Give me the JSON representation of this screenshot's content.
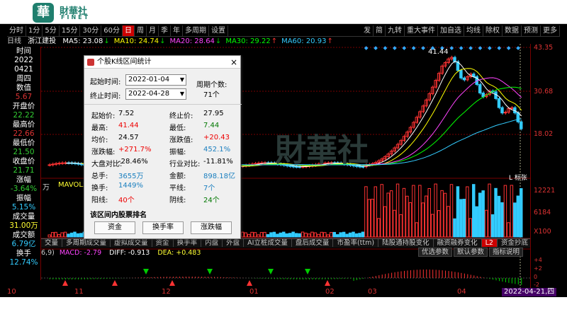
{
  "brand": {
    "logo_glyph": "華",
    "name_cn": "財華社",
    "name_en": "FINET",
    "accent": "#1f7f6e"
  },
  "toolbar": {
    "left": [
      "分时",
      "1分",
      "5分",
      "15分",
      "30分",
      "60分",
      "日",
      "周",
      "月",
      "季",
      "年",
      "多周期",
      "设置"
    ],
    "active": "日",
    "right": [
      "发",
      "简",
      "九转",
      "重大事件",
      "加自选",
      "均线",
      "除权",
      "数据",
      "预测",
      "更多"
    ]
  },
  "ma_legend": {
    "period_label": "日线",
    "stock": "浙江建投",
    "items": [
      {
        "label": "MA5: 23.08",
        "color": "#ffffff",
        "arrow": "↓",
        "arrow_color": "#00cc00"
      },
      {
        "label": "MA10: 24.74",
        "color": "#ffff00",
        "arrow": "↓",
        "arrow_color": "#00cc00"
      },
      {
        "label": "MA20: 28.64",
        "color": "#ff44ff",
        "arrow": "↓",
        "arrow_color": "#00cc00"
      },
      {
        "label": "MA30: 29.22",
        "color": "#00ff00",
        "arrow": "↑",
        "arrow_color": "#ff3333"
      },
      {
        "label": "MA60: 20.93",
        "color": "#33ccff",
        "arrow": "↑",
        "arrow_color": "#ff3333"
      }
    ]
  },
  "left_panel": [
    {
      "t": "时间",
      "c": "#ffffff"
    },
    {
      "t": "2022",
      "c": "#ffffff"
    },
    {
      "t": "0421",
      "c": "#ffffff"
    },
    {
      "t": "周四",
      "c": "#ffffff"
    },
    {
      "t": "数值",
      "c": "#ffffff"
    },
    {
      "t": "5.67",
      "c": "#dd3333"
    },
    {
      "t": "开盘价",
      "c": "#ffffff"
    },
    {
      "t": "22.22",
      "c": "#33cc33"
    },
    {
      "t": "最高价",
      "c": "#ffffff"
    },
    {
      "t": "22.66",
      "c": "#dd3333"
    },
    {
      "t": "最低价",
      "c": "#ffffff"
    },
    {
      "t": "21.50",
      "c": "#33cc33"
    },
    {
      "t": "收盘价",
      "c": "#ffffff"
    },
    {
      "t": "21.71",
      "c": "#33cc33"
    },
    {
      "t": "涨幅",
      "c": "#ffffff"
    },
    {
      "t": "-3.64%",
      "c": "#33cc33"
    },
    {
      "t": "振幅",
      "c": "#ffffff"
    },
    {
      "t": "5.15%",
      "c": "#33ccff"
    },
    {
      "t": "成交量",
      "c": "#ffffff"
    },
    {
      "t": "31.00万",
      "c": "#ffff33"
    },
    {
      "t": "成交额",
      "c": "#ffffff"
    },
    {
      "t": "6.79亿",
      "c": "#33ccff"
    },
    {
      "t": "换手",
      "c": "#ffffff"
    },
    {
      "t": "12.74%",
      "c": "#33ccff"
    }
  ],
  "price_axis": [
    "43.35",
    "30.68",
    "18.02"
  ],
  "volume_axis": [
    "12221",
    "6184",
    "X100"
  ],
  "macd_axis": [
    "+4",
    "+2",
    "0",
    "-2"
  ],
  "peak_label": "41.44",
  "corner_label": "L 标张",
  "vol_legend": {
    "prefix": "万",
    "label": "MAVOL5"
  },
  "tabs": [
    "交量",
    "多周期成交量",
    "虚拟成交量",
    "资金",
    "换手率",
    "内盘",
    "外盘",
    "AI立桩成交量",
    "盘后成交量",
    "市盈率(ttm)",
    "陆股通持股变化",
    "融资融券变化",
    "L2",
    "资金抄底"
  ],
  "macd": {
    "params": "6,9)",
    "macd": "MACD: -2.79",
    "diff": "DIFF: -0.913",
    "dea": "DEA: +0.483",
    "tabs": [
      "优选参数",
      "默认参数",
      "指标说明"
    ]
  },
  "x_axis": [
    {
      "l": "10",
      "p": 0
    },
    {
      "l": "11",
      "p": 95
    },
    {
      "l": "12",
      "p": 218
    },
    {
      "l": "01",
      "p": 342
    },
    {
      "l": "02",
      "p": 449
    },
    {
      "l": "03",
      "p": 509
    },
    {
      "l": "04",
      "p": 635
    }
  ],
  "date_badge": "2022-04-21,四",
  "dialog": {
    "title": "个股K线区间统计",
    "start_label": "起始时间:",
    "start": "2022-01-04",
    "end_label": "终止时间:",
    "end": "2022-04-28",
    "period_label": "周期个数:",
    "period_count": "71个",
    "rows": [
      [
        {
          "k": "起始价:",
          "v": "7.52",
          "c": ""
        },
        {
          "k": "终止价:",
          "v": "27.95",
          "c": ""
        }
      ],
      [
        {
          "k": "最高:",
          "v": "41.44",
          "c": "red"
        },
        {
          "k": "最低:",
          "v": "7.44",
          "c": "green"
        }
      ],
      [
        {
          "k": "均价:",
          "v": "24.57",
          "c": ""
        },
        {
          "k": "涨跌值:",
          "v": "+20.43",
          "c": "red"
        }
      ],
      [
        {
          "k": "涨跌幅:",
          "v": "+271.7%",
          "c": "red"
        },
        {
          "k": "振幅:",
          "v": "452.1%",
          "c": "blue"
        }
      ],
      [
        {
          "k": "大盘对比:",
          "v": "-28.46%",
          "c": ""
        },
        {
          "k": "行业对比:",
          "v": "-11.81%",
          "c": ""
        }
      ],
      [
        {
          "k": "总手:",
          "v": "3655万",
          "c": "blue"
        },
        {
          "k": "金额:",
          "v": "898.18亿",
          "c": "blue"
        }
      ],
      [
        {
          "k": "换手:",
          "v": "1449%",
          "c": "blue"
        },
        {
          "k": "平线:",
          "v": "7个",
          "c": "blue"
        }
      ],
      [
        {
          "k": "阳线:",
          "v": "40个",
          "c": "red"
        },
        {
          "k": "阴线:",
          "v": "24个",
          "c": "green"
        }
      ]
    ],
    "rank_label": "该区间内股票排名",
    "buttons": [
      "资金",
      "换手率",
      "涨跌幅"
    ]
  }
}
